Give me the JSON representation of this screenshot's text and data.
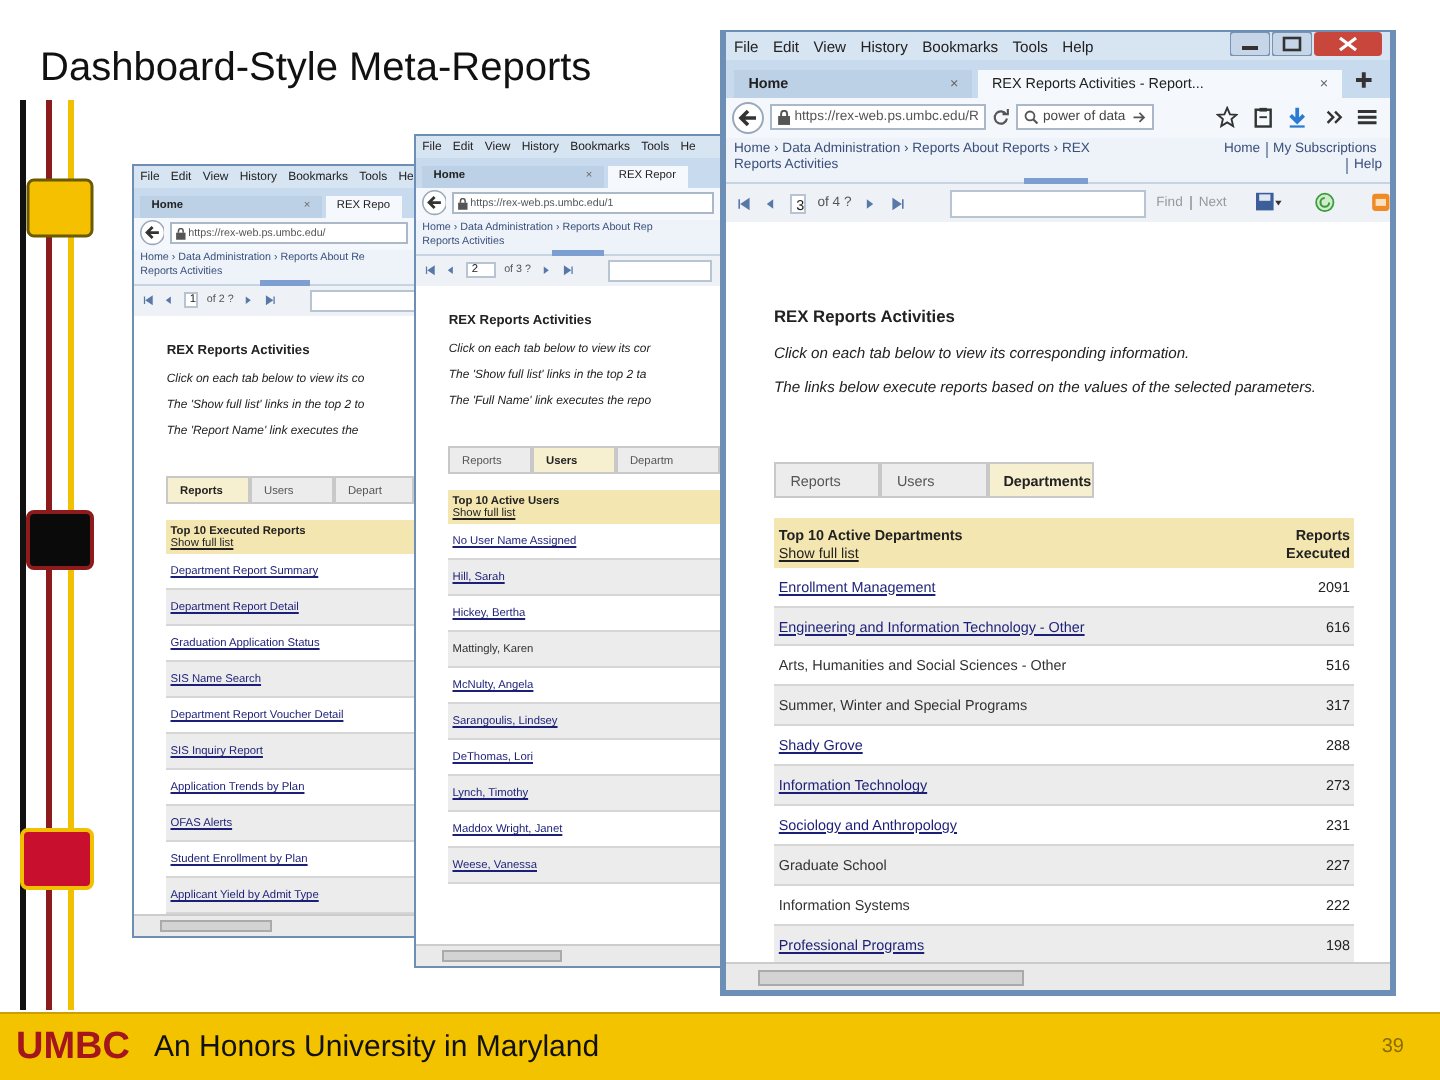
{
  "slide": {
    "title": "Dashboard-Style Meta-Reports",
    "footer": {
      "logo": "UMBC",
      "tagline": "An Honors University in Maryland",
      "page_number": "39"
    }
  },
  "windows": [
    {
      "menu": [
        "File",
        "Edit",
        "View",
        "History",
        "Bookmarks",
        "Tools",
        "He"
      ],
      "tabs": [
        {
          "label": "Home",
          "close": "×",
          "selected": false
        },
        {
          "label": "REX Repo",
          "selected": true
        }
      ],
      "url": "https://rex-web.ps.umbc.edu/",
      "breadcrumb": [
        "Home › Data Administration › Reports About Re",
        "Reports Activities"
      ],
      "page": "1",
      "page_count": "of 2 ?",
      "heading": "REX Reports Activities",
      "notes": [
        "Click on each tab below to view its co",
        "The 'Show full list' links in the top 2 to",
        "The 'Report Name' link executes the"
      ],
      "report_tabs": [
        {
          "label": "Reports",
          "selected": true
        },
        {
          "label": "Users",
          "selected": false
        },
        {
          "label": "Depart",
          "selected": false
        }
      ],
      "table": {
        "title": "Top 10 Executed Reports",
        "show_all": "Show full list",
        "rows": [
          {
            "name": "Department Report Summary",
            "link": true
          },
          {
            "name": "Department Report Detail",
            "link": true
          },
          {
            "name": "Graduation Application Status",
            "link": true
          },
          {
            "name": "SIS Name Search",
            "link": true
          },
          {
            "name": "Department Report Voucher Detail",
            "link": true
          },
          {
            "name": "SIS Inquiry Report",
            "link": true
          },
          {
            "name": "Application Trends by Plan",
            "link": true
          },
          {
            "name": "OFAS Alerts",
            "link": true
          },
          {
            "name": "Student Enrollment by Plan",
            "link": true
          },
          {
            "name": "Applicant Yield by Admit Type",
            "link": true
          }
        ]
      }
    },
    {
      "menu": [
        "File",
        "Edit",
        "View",
        "History",
        "Bookmarks",
        "Tools",
        "He"
      ],
      "tabs": [
        {
          "label": "Home",
          "close": "×",
          "selected": false
        },
        {
          "label": "REX Repor",
          "selected": true
        }
      ],
      "url": "https://rex-web.ps.umbc.edu/1",
      "breadcrumb": [
        "Home › Data Administration › Reports About Rep",
        "Reports Activities"
      ],
      "page": "2",
      "page_count": "of 3 ?",
      "heading": "REX Reports Activities",
      "notes": [
        "Click on each tab below to view its cor",
        "The 'Show full list' links in the top 2 ta",
        "The 'Full Name' link executes the repo"
      ],
      "report_tabs": [
        {
          "label": "Reports",
          "selected": false
        },
        {
          "label": "Users",
          "selected": true
        },
        {
          "label": "Departm",
          "selected": false
        }
      ],
      "table": {
        "title": "Top 10 Active Users",
        "show_all": "Show full list",
        "rows": [
          {
            "name": "No User Name Assigned",
            "link": true
          },
          {
            "name": "Hill, Sarah",
            "link": true
          },
          {
            "name": "Hickey, Bertha",
            "link": true
          },
          {
            "name": "Mattingly, Karen",
            "link": false
          },
          {
            "name": "McNulty, Angela",
            "link": true
          },
          {
            "name": "Sarangoulis, Lindsey",
            "link": true
          },
          {
            "name": "DeThomas, Lori",
            "link": true
          },
          {
            "name": "Lynch, Timothy",
            "link": true
          },
          {
            "name": "Maddox Wright, Janet",
            "link": true
          },
          {
            "name": "Weese, Vanessa",
            "link": true
          }
        ]
      }
    },
    {
      "menu": [
        "File",
        "Edit",
        "View",
        "History",
        "Bookmarks",
        "Tools",
        "Help"
      ],
      "controls": true,
      "tabs": [
        {
          "label": "Home",
          "close": "×",
          "selected": false
        },
        {
          "label": "REX Reports Activities - Report...",
          "close": "×",
          "selected": true
        }
      ],
      "url": "https://rex-web.ps.umbc.edu/R",
      "search": "power of data",
      "breadcrumb": [
        "Home › Data Administration › Reports About Reports › REX",
        "Reports Activities"
      ],
      "top_links": [
        "Home",
        "My Subscriptions",
        "Help"
      ],
      "page": "3",
      "page_count": "of 4 ?",
      "find_links": [
        "Find",
        "Next"
      ],
      "heading": "REX Reports Activities",
      "notes": [
        "Click on each tab below to view its corresponding information.",
        "The links below execute reports based on the values of the selected parameters."
      ],
      "report_tabs": [
        {
          "label": "Reports",
          "selected": false
        },
        {
          "label": "Users",
          "selected": false
        },
        {
          "label": "Departments",
          "selected": true
        }
      ],
      "table": {
        "title": "Top 10 Active Departments",
        "show_all": "Show full list",
        "value_heading": "Reports Executed",
        "rows": [
          {
            "name": "Enrollment Management",
            "value": "2091",
            "link": true
          },
          {
            "name": "Engineering and Information Technology - Other",
            "value": "616",
            "link": true
          },
          {
            "name": "Arts, Humanities and Social Sciences - Other",
            "value": "516",
            "link": false
          },
          {
            "name": "Summer, Winter and Special Programs",
            "value": "317",
            "link": false
          },
          {
            "name": "Shady Grove",
            "value": "288",
            "link": true
          },
          {
            "name": "Information Technology",
            "value": "273",
            "link": true
          },
          {
            "name": "Sociology and Anthropology",
            "value": "231",
            "link": true
          },
          {
            "name": "Graduate School",
            "value": "227",
            "link": false
          },
          {
            "name": "Information Systems",
            "value": "222",
            "link": false
          },
          {
            "name": "Professional Programs",
            "value": "198",
            "link": true
          }
        ]
      }
    }
  ]
}
